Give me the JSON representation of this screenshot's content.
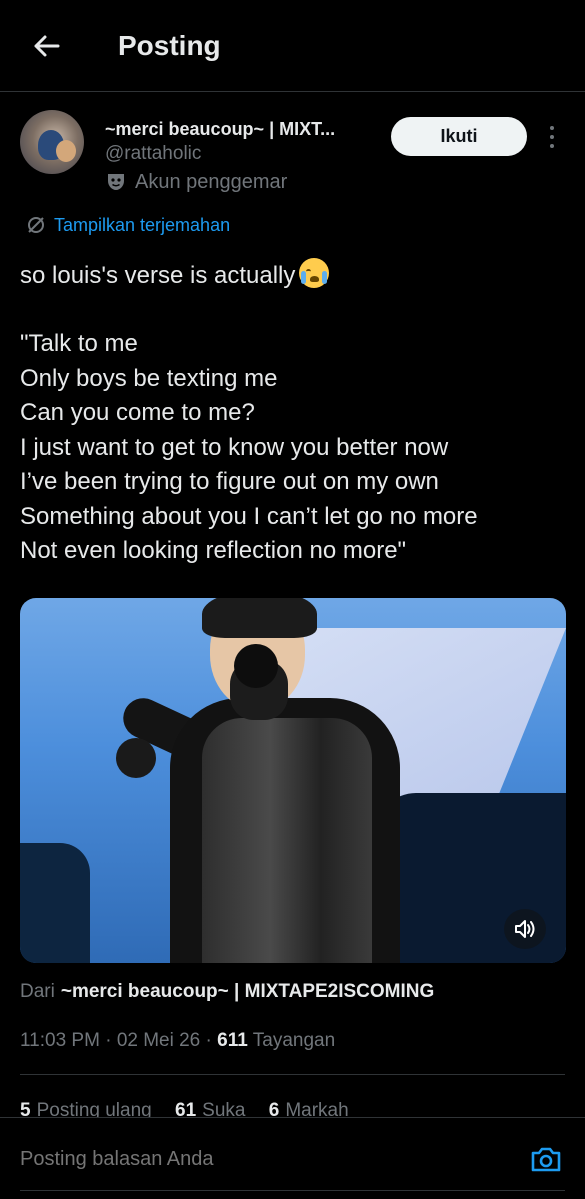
{
  "header": {
    "back_icon": "arrow-left-icon",
    "title": "Posting"
  },
  "author": {
    "name": "~merci beaucoup~ | MIXT...",
    "handle": "@rattaholic",
    "badge_icon": "theater-mask-icon",
    "badge_label": "Akun penggemar",
    "follow_label": "Ikuti",
    "more_icon": "more-vertical-icon"
  },
  "translate": {
    "icon": "translate-icon",
    "label": "Tampilkan terjemahan"
  },
  "tweet": {
    "lines": [
      "so louis's verse is actually",
      "",
      "\"Talk to me",
      "Only boys be texting me",
      "Can you come to me?",
      "I just want to get to know you better now",
      "I’ve been trying to figure out on my own",
      "Something about you I can’t let go no more",
      "Not even looking reflection no more\""
    ],
    "emoji": "loudly-crying-face"
  },
  "media": {
    "type": "video",
    "sound_icon": "speaker-icon"
  },
  "source": {
    "prefix": "Dari",
    "name": "~merci beaucoup~ | MIXTAPE2ISCOMING"
  },
  "meta": {
    "time": "11:03 PM",
    "separator": "·",
    "date": "02 Mei 26",
    "views_count": "611",
    "views_label": "Tayangan"
  },
  "stats": [
    {
      "count": "5",
      "label": "Posting ulang"
    },
    {
      "count": "61",
      "label": "Suka"
    },
    {
      "count": "6",
      "label": "Markah"
    }
  ],
  "reply": {
    "placeholder": "Posting balasan Anda",
    "camera_icon": "camera-icon"
  },
  "colors": {
    "background": "#000000",
    "text": "#e7e9ea",
    "muted": "#71767b",
    "accent": "#1d9bf0",
    "follow_bg": "#eff3f4",
    "divider": "#2f3336"
  }
}
